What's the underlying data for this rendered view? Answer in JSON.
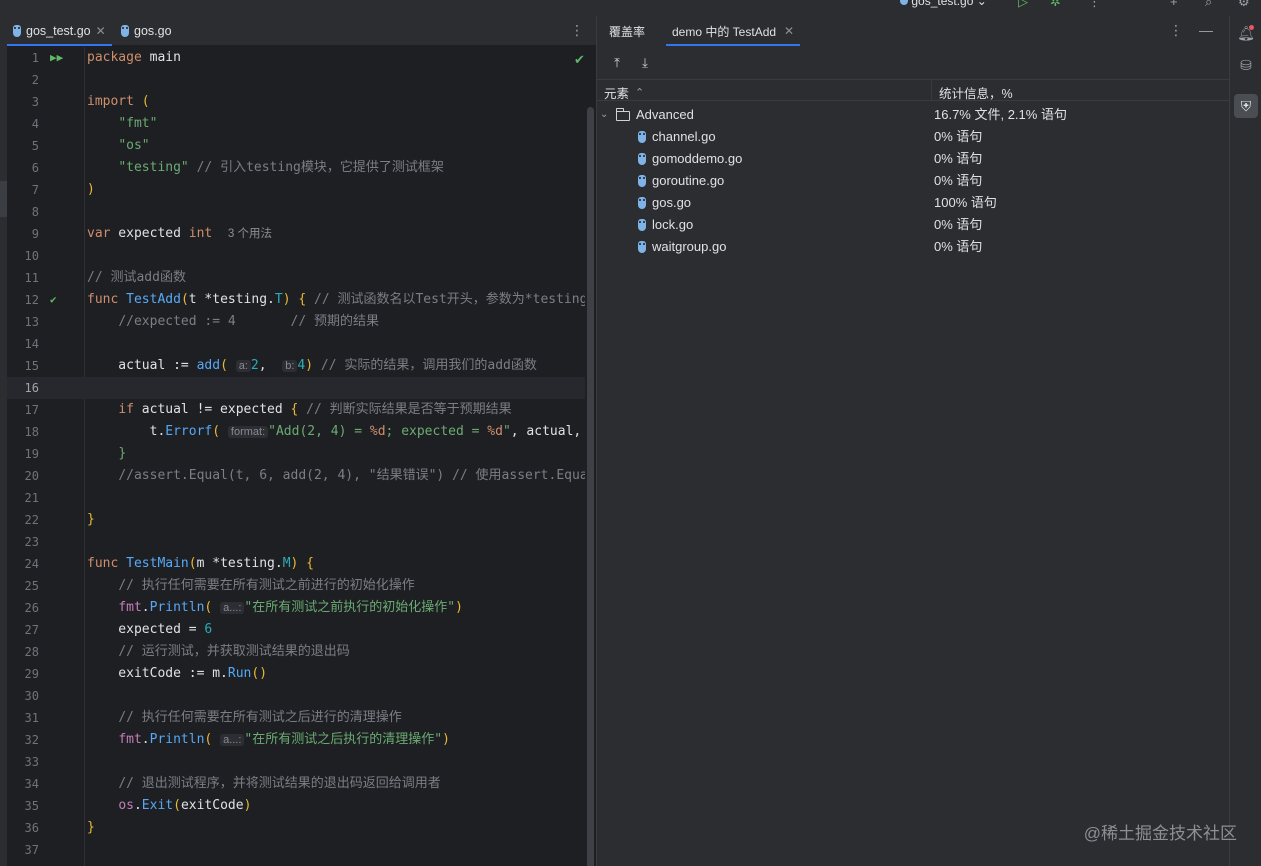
{
  "toolbar": {
    "run_config_label": "gos_test.go",
    "run_icon": "run-icon",
    "debug_icon": "debug-icon",
    "more_icon": "more-vertical-icon"
  },
  "editor": {
    "tabs": [
      {
        "label": "gos_test.go",
        "active": true
      },
      {
        "label": "gos.go",
        "active": false
      }
    ],
    "usage_hint": "3 个用法",
    "hints": {
      "a": "a:",
      "b": "b:",
      "format": "format:",
      "a_ellipsis": "a...:"
    },
    "line_numbers": [
      "1",
      "2",
      "3",
      "4",
      "5",
      "6",
      "7",
      "8",
      "9",
      "10",
      "11",
      "12",
      "13",
      "14",
      "15",
      "16",
      "17",
      "18",
      "19",
      "20",
      "21",
      "22",
      "23",
      "24",
      "25",
      "26",
      "27",
      "28",
      "29",
      "30",
      "31",
      "32",
      "33",
      "34",
      "35",
      "36",
      "37"
    ],
    "current_line": 16
  },
  "coverage": {
    "tabs": [
      {
        "label": "覆盖率"
      },
      {
        "label": "demo 中的 TestAdd"
      }
    ],
    "columns": {
      "element": "元素",
      "stats": "统计信息，%"
    },
    "rows": [
      {
        "name": "Advanced",
        "stat": "16.7% 文件, 2.1% 语句",
        "type": "folder"
      },
      {
        "name": "channel.go",
        "stat": "0% 语句",
        "type": "file"
      },
      {
        "name": "gomoddemo.go",
        "stat": "0% 语句",
        "type": "file"
      },
      {
        "name": "goroutine.go",
        "stat": "0% 语句",
        "type": "file"
      },
      {
        "name": "gos.go",
        "stat": "100% 语句",
        "type": "file"
      },
      {
        "name": "lock.go",
        "stat": "0% 语句",
        "type": "file"
      },
      {
        "name": "waitgroup.go",
        "stat": "0% 语句",
        "type": "file"
      }
    ]
  },
  "colors": {
    "accent": "#3574f0",
    "keyword": "#cf8e6d",
    "function": "#56a8f5",
    "string": "#6aab73",
    "comment": "#7a7e85",
    "number": "#2aacb8",
    "run_green": "#5fb865"
  },
  "watermark": "@稀土掘金技术社区"
}
